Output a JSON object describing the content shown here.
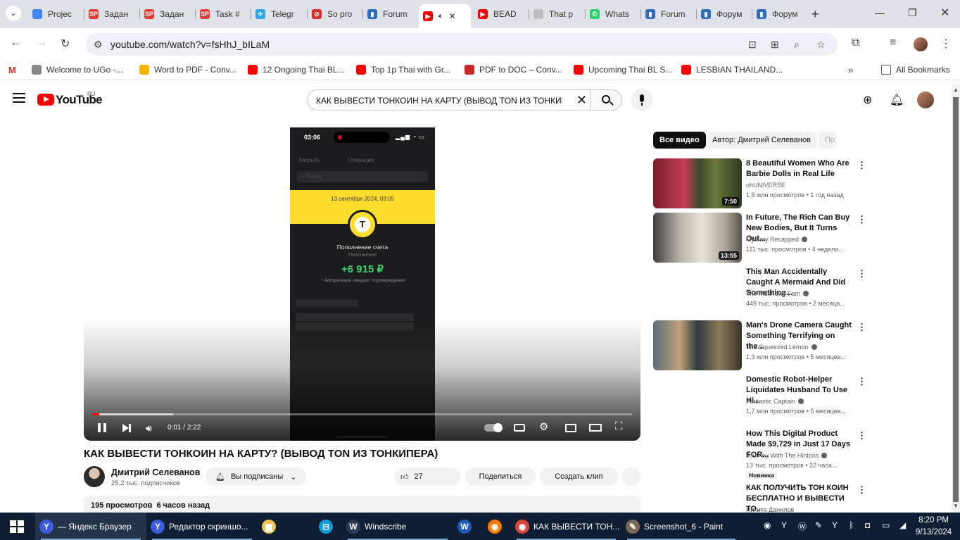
{
  "browser": {
    "tabs": [
      {
        "label": "Projec",
        "color": "#4285f4"
      },
      {
        "label": "Задан",
        "color": "#e53935"
      },
      {
        "label": "Задан",
        "color": "#e53935"
      },
      {
        "label": "Task #",
        "color": "#e53935"
      },
      {
        "label": "Telegr",
        "color": "#29a9eb"
      },
      {
        "label": "So pro",
        "color": "#d93025"
      },
      {
        "label": "Forum",
        "color": "#2c6ebd"
      },
      {
        "label": "",
        "color": "#ff0000"
      },
      {
        "label": "BEAD",
        "color": "#ff0000"
      },
      {
        "label": "That p",
        "color": "#bdbdbd"
      },
      {
        "label": "Whats",
        "color": "#25d366"
      },
      {
        "label": "Forum",
        "color": "#2c6ebd"
      },
      {
        "label": "Форум",
        "color": "#2c6ebd"
      },
      {
        "label": "Форум",
        "color": "#2c6ebd"
      }
    ],
    "url": "youtube.com/watch?v=fsHhJ_bILaM",
    "bookmarks": [
      {
        "label": "Welcome to UGo -...",
        "color": "#888"
      },
      {
        "label": "Word to PDF - Conv...",
        "color": "#f4b400"
      },
      {
        "label": "12 Ongoing Thai BL...",
        "color": "#ff0000"
      },
      {
        "label": "Top 1p Thai with Gr...",
        "color": "#ff0000"
      },
      {
        "label": "PDF to DOC – Conv...",
        "color": "#c62828"
      },
      {
        "label": "Upcoming Thai BL S...",
        "color": "#ff0000"
      },
      {
        "label": "LESBIAN THAILAND...",
        "color": "#ff0000"
      }
    ],
    "all_bookmarks": "All Bookmarks"
  },
  "youtube": {
    "logo_text": "YouTube",
    "region": "RU",
    "search_query": "КАК ВЫВЕСТИ ТОНКОИН НА КАРТУ (ВЫВОД TON ИЗ ТОНКИП",
    "keyboard_glyph": "⌨"
  },
  "video": {
    "phone": {
      "time": "03:06",
      "signal": "▂▄▆ ◔ ▭",
      "close": "Закрыть",
      "header": "Операции",
      "search": "Поиск",
      "date": "13 сентября 2024, 03:05",
      "logo": "T",
      "title": "Пополнение счета",
      "subtitle": "Пополнения",
      "amount": "+6 915 ₽",
      "pending": "Авторизация ожидает подтверждения"
    },
    "time_current": "0:01",
    "time_total": "2:22",
    "progress": 0.012,
    "buffered": 0.15,
    "title": "КАК ВЫВЕСТИ ТОНКОИН НА КАРТУ? (ВЫВОД TON ИЗ ТОНКИПЕРА)",
    "channel": "Дмитрий Селеванов",
    "subscribers": "25,2 тыс. подписчиков",
    "subscribed_label": "Вы подписаны",
    "likes": "27",
    "share_label": "Поделиться",
    "clip_label": "Создать клип",
    "views": "195 просмотров",
    "posted": "6 часов назад"
  },
  "sidebar": {
    "chips": [
      "Все видео",
      "Автор: Дмитрий Селеванов",
      "Пр"
    ],
    "videos": [
      {
        "title": "8 Beautiful Women Who Are Barbie Dolls in Real Life",
        "channel": "ohUNIVERSE",
        "verified": false,
        "meta": "1,8 млн просмотров • 1 год назад",
        "duration": "7:50",
        "badge": ""
      },
      {
        "title": "In Future, The Rich Can Buy New Bodies, But It Turns Out...",
        "channel": "Mystery Recapped",
        "verified": true,
        "meta": "111 тыс. просмотров • 4 недели...",
        "duration": "13:55",
        "badge": ""
      },
      {
        "title": "This Man Accidentally Caught A Mermaid And Did Something...",
        "channel": "The Matthews Fam",
        "verified": true,
        "meta": "449 тыс. просмотров • 2 месяца...",
        "duration": "",
        "badge": ""
      },
      {
        "title": "Man's Drone Camera Caught Something Terrifying on the...",
        "channel": "The Squeezed Lemon",
        "verified": true,
        "meta": "1,3 млн просмотров • 5 месяцев...",
        "duration": "",
        "badge": ""
      },
      {
        "title": "Domestic Robot-Helper Liquidates Husband To Use Hi...",
        "channel": "Fantastic Captain",
        "verified": true,
        "meta": "1,7 млн просмотров • 5 месяцев...",
        "duration": "",
        "badge": ""
      },
      {
        "title": "How This Digital Product Made $9,729 in Just 17 Days FOR...",
        "channel": "Journey With The Hintons",
        "verified": true,
        "meta": "13 тыс. просмотров • 22 часа...",
        "duration": "",
        "badge": "Новинка"
      },
      {
        "title": "КАК ПОЛУЧИТЬ ТОН КОИН БЕСПЛАТНО И ВЫВЕСТИ ТО...",
        "channel": "Никита Данилов",
        "verified": false,
        "meta": "",
        "duration": "",
        "badge": ""
      }
    ]
  },
  "taskbar": {
    "apps": [
      {
        "label": "— Яндекс Браузер",
        "color": "#3b5bdb",
        "glyph": "Y"
      },
      {
        "label": "Редактор скриншо...",
        "color": "#3b5bdb",
        "glyph": "Y"
      },
      {
        "label": "",
        "color": "#f2c14e",
        "glyph": "▆"
      },
      {
        "label": "",
        "color": "#0e9ad8",
        "glyph": "⊟"
      },
      {
        "label": "Windscribe",
        "color": "#2b3a55",
        "glyph": "W"
      },
      {
        "label": "",
        "color": "#1e5bb8",
        "glyph": "W"
      },
      {
        "label": "",
        "color": "#ff7a00",
        "glyph": "◉"
      },
      {
        "label": "КАК ВЫВЕСТИ ТОН...",
        "color": "#db4437",
        "glyph": "◉"
      },
      {
        "label": "Screenshot_6 - Paint",
        "color": "#7a6a55",
        "glyph": "✎"
      }
    ],
    "time": "8:20 PM",
    "date": "9/13/2024"
  }
}
